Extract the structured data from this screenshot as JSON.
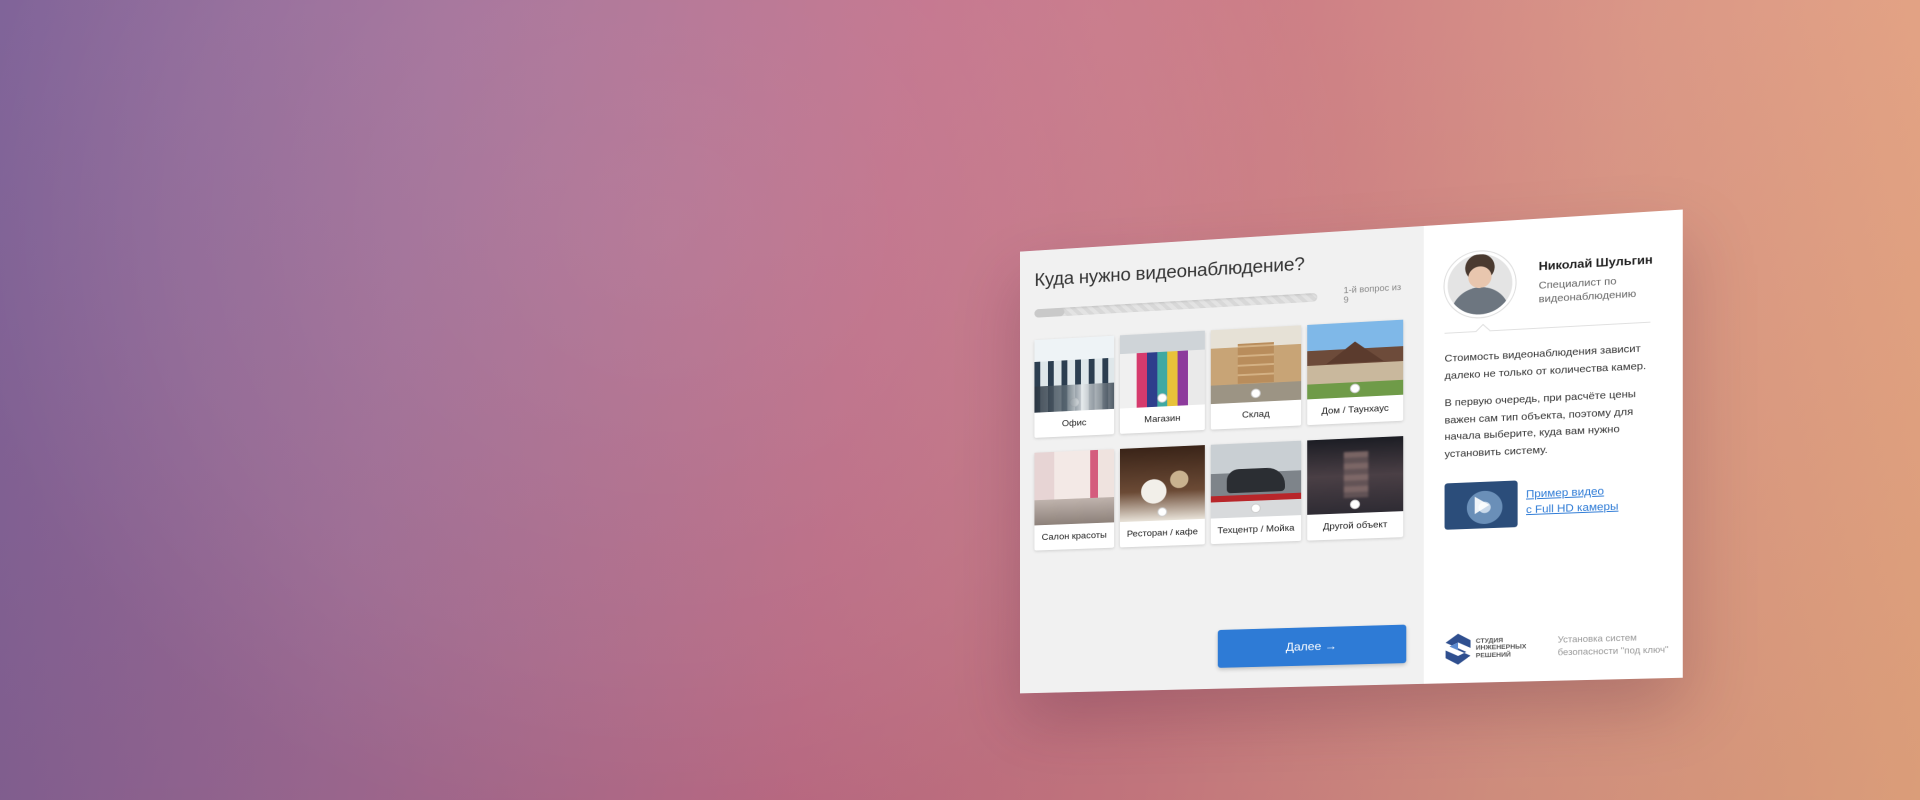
{
  "quiz": {
    "title": "Куда нужно видеонаблюдение?",
    "progress_text": "1-й вопрос из 9",
    "progress_fraction": 0.11,
    "options": [
      {
        "label": "Офис"
      },
      {
        "label": "Магазин"
      },
      {
        "label": "Склад"
      },
      {
        "label": "Дом / Таунхаус"
      },
      {
        "label": "Салон красоты"
      },
      {
        "label": "Ресторан / кафе"
      },
      {
        "label": "Техцентр / Мойка"
      },
      {
        "label": "Другой объект"
      }
    ],
    "next_button": "Далее →",
    "accent_color": "#2e7bd6"
  },
  "consultant": {
    "name": "Николай Шульгин",
    "role": "Специалист по видеонаблюдению",
    "paragraph1": "Стоимость видеонаблюдения зависит далеко не только от количества камер.",
    "paragraph2": "В первую очередь, при расчёте цены важен сам тип объекта, поэтому для начала выберите, куда вам нужно установить систему.",
    "video_link_line1": "Пример видео",
    "video_link_line2": "с Full HD камеры"
  },
  "footer": {
    "logo_line1": "СТУДИЯ",
    "logo_line2": "ИНЖЕНЕРНЫХ",
    "logo_line3": "РЕШЕНИЙ",
    "note_line1": "Установка систем",
    "note_line2": "безопасности \"под ключ\""
  }
}
